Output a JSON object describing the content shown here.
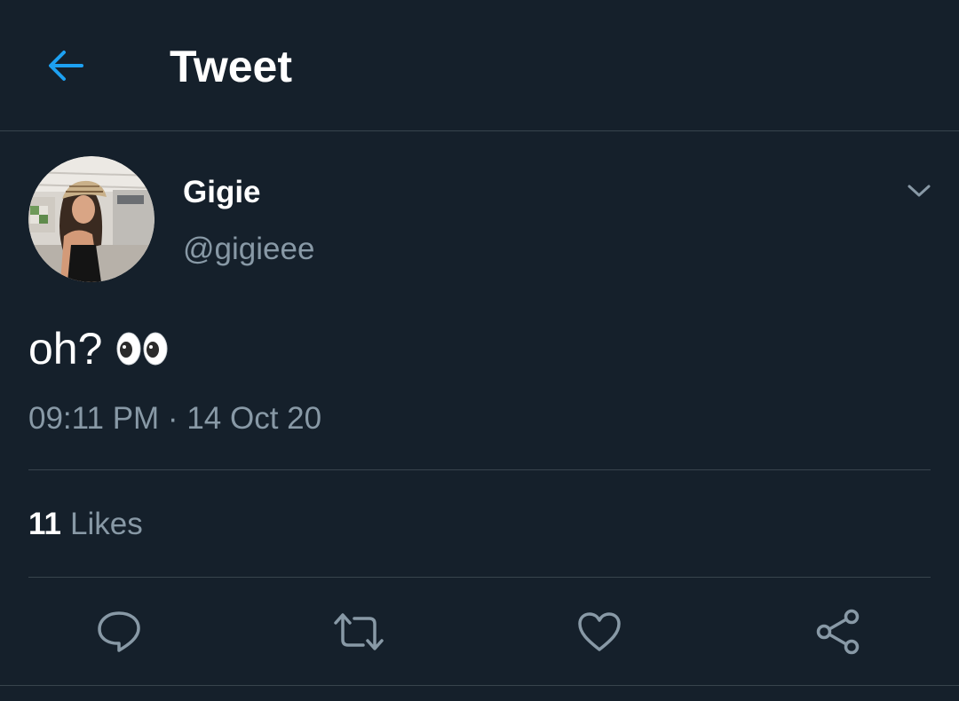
{
  "header": {
    "title": "Tweet",
    "back_icon": "arrow-left-icon"
  },
  "author": {
    "display_name": "Gigie",
    "handle": "@gigieee",
    "menu_icon": "chevron-down-icon"
  },
  "tweet": {
    "text": "oh?",
    "emoji": "eyes-emoji",
    "timestamp": "09:11 PM · 14 Oct 20"
  },
  "stats": {
    "likes_count": "11",
    "likes_label": "Likes"
  },
  "actions": [
    {
      "name": "reply",
      "icon": "reply-icon"
    },
    {
      "name": "retweet",
      "icon": "retweet-icon"
    },
    {
      "name": "like",
      "icon": "heart-icon"
    },
    {
      "name": "share",
      "icon": "share-icon"
    }
  ],
  "colors": {
    "background": "#15202b",
    "accent": "#1da1f2",
    "secondary_text": "#8899a6",
    "divider": "#38444d"
  }
}
